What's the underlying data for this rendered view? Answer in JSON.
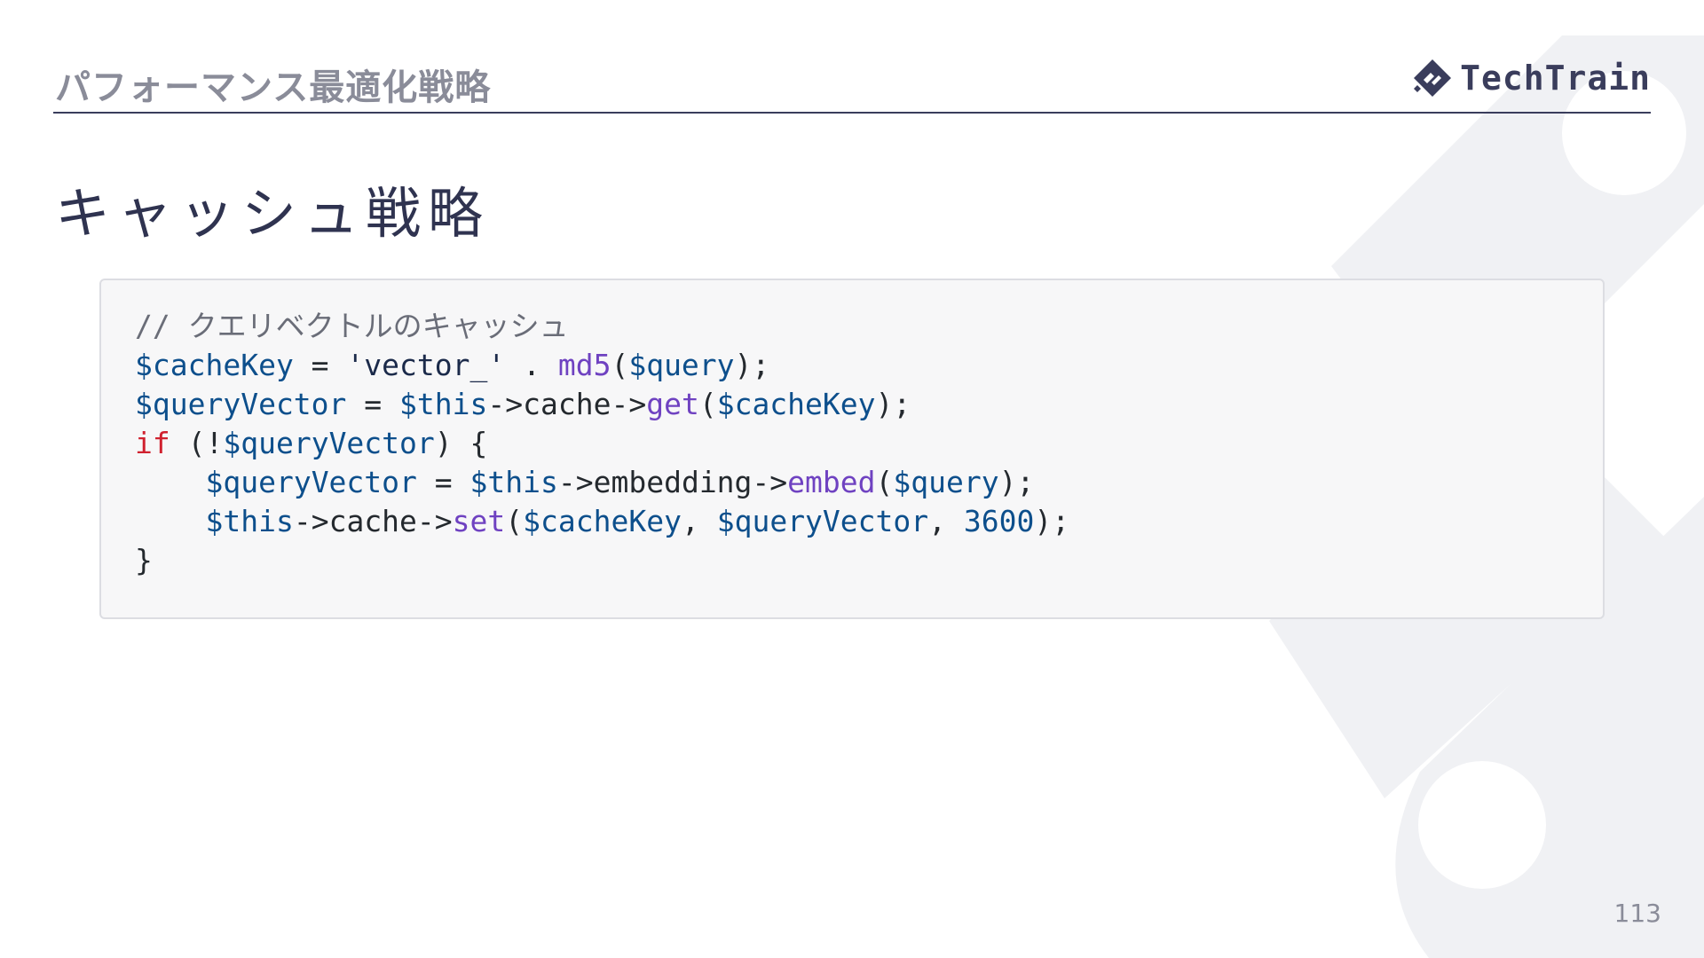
{
  "header": {
    "section_title": "パフォーマンス最適化戦略",
    "logo_text": "TechTrain",
    "logo_icon": "techtrain-diamond-logo"
  },
  "slide": {
    "title": "キャッシュ戦略",
    "page_number": "113"
  },
  "code": {
    "language": "php",
    "comment": "// クエリベクトルのキャッシュ",
    "tokens": {
      "cache_key": "$cacheKey",
      "query": "$query",
      "query_vector": "$queryVector",
      "this": "$this",
      "str_vector": "'vector_'",
      "fn_md5": "md5",
      "fn_get": "get",
      "fn_embed": "embed",
      "fn_set": "set",
      "kw_if": "if",
      "prop_cache": "cache",
      "prop_embedding": "embedding",
      "ttl": "3600"
    }
  },
  "colors": {
    "accent": "#3a3d5c",
    "muted": "#8a8c99",
    "code_background": "#f7f7f8",
    "code_keyword": "#d0212f",
    "code_variable": "#0d4f8c",
    "code_function": "#6f42c1"
  }
}
